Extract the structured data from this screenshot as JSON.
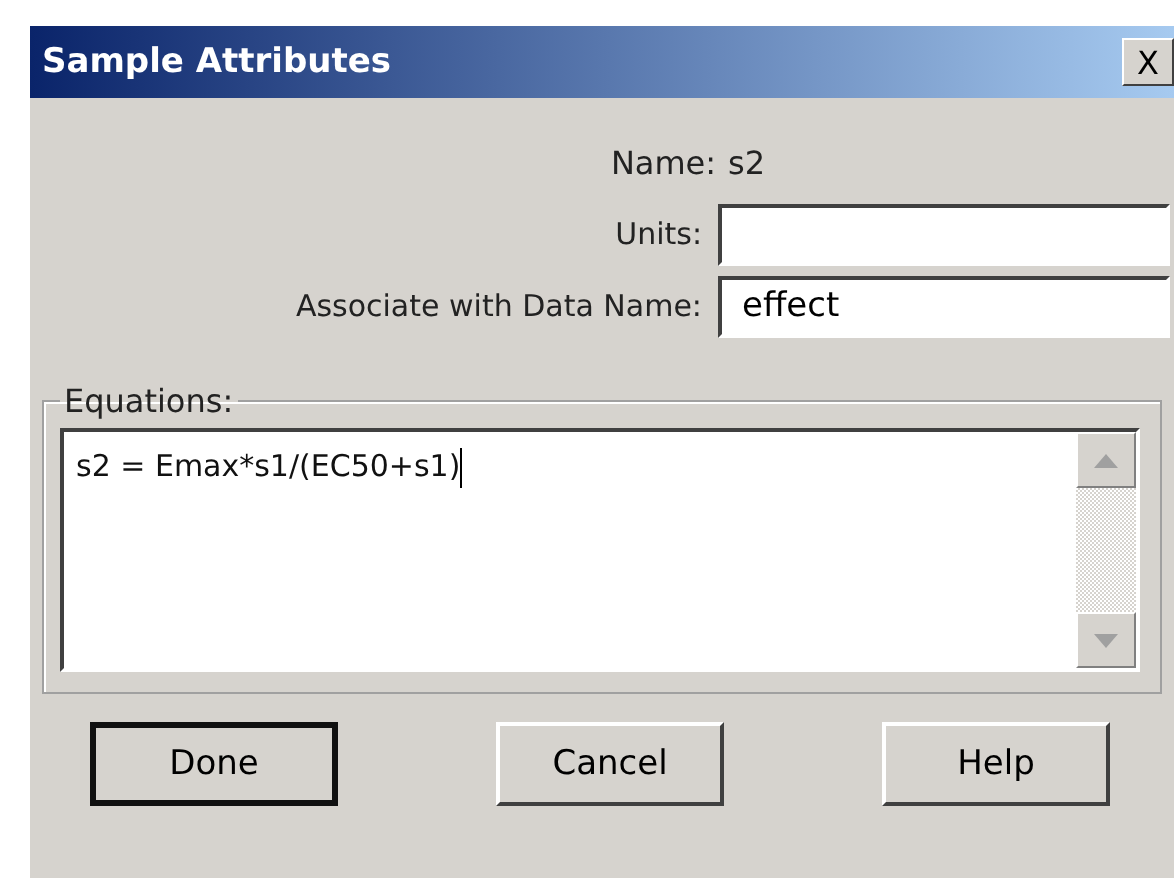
{
  "window": {
    "title": "Sample Attributes",
    "close": "X"
  },
  "name_row": {
    "label": "Name:",
    "value": "s2"
  },
  "fields": [
    {
      "label": "Units:"
    },
    {
      "label": "Associate with Data Name:",
      "value": "effect"
    }
  ],
  "equations": {
    "legend": "Equations:",
    "value": "s2 = Emax*s1/(EC50+s1)"
  },
  "buttons": [
    {
      "label": "Done",
      "default": true
    },
    {
      "label": "Cancel",
      "default": false
    },
    {
      "label": "Help",
      "default": false
    }
  ]
}
